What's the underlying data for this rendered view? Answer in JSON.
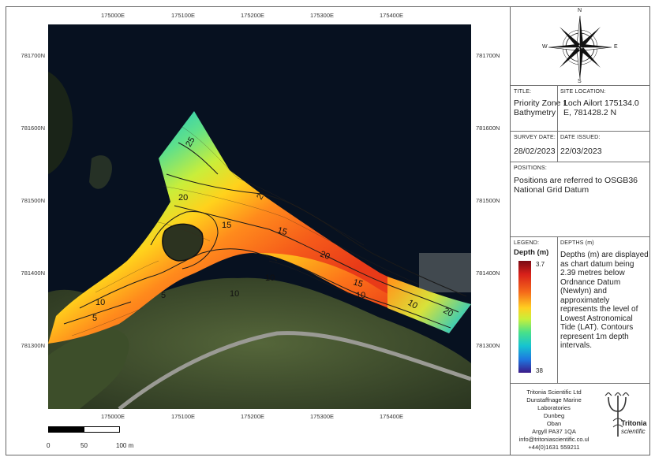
{
  "map": {
    "top_ticks": [
      "175000E",
      "175100E",
      "175200E",
      "175300E",
      "175400E"
    ],
    "bottom_ticks": [
      "175000E",
      "175100E",
      "175200E",
      "175300E",
      "175400E"
    ],
    "left_ticks": [
      "781700N",
      "781600N",
      "781500N",
      "781400N",
      "781300N"
    ],
    "right_ticks": [
      "781700N",
      "781600N",
      "781500N",
      "781400N",
      "781300N"
    ],
    "contour_labels": [
      "25",
      "20",
      "20",
      "15",
      "20",
      "15",
      "15",
      "10",
      "10",
      "10",
      "5",
      "10",
      "5",
      "20",
      "10"
    ],
    "colors": {
      "water": "#071120",
      "land": "#3a4a2a",
      "road": "#9a9a94"
    }
  },
  "compass": {
    "n": "N",
    "s": "S",
    "e": "E",
    "w": "W"
  },
  "title_block": {
    "title_label": "TITLE:",
    "title_value": "Priority Zone 1 Bathymetry",
    "site_label": "SITE LOCATION:",
    "site_value": "Loch Ailort 175134.0 E, 781428.2 N",
    "survey_label": "SURVEY DATE:",
    "survey_value": "28/02/2023",
    "issued_label": "DATE ISSUED:",
    "issued_value": "22/03/2023",
    "positions_label": "POSITIONS:",
    "positions_value": "Positions are referred to OSGB36 National Grid Datum"
  },
  "legend": {
    "label": "LEGEND:",
    "title": "Depth (m)",
    "max": "3.7",
    "min": "38",
    "depths_label": "DEPTHS (m)",
    "depths_text": "Depths (m) are displayed as chart datum being 2.39 metres below Ordnance Datum (Newlyn) and approximately represents the level of Lowest Astronomical Tide (LAT). Contours represent 1m depth intervals."
  },
  "company": {
    "lines": [
      "Tritonia Scientific Ltd",
      "Dunstaffnage Marine",
      "Laboratories",
      "Dunbeg",
      "Oban",
      "Argyll PA37 1QA",
      "info@tritoniascientific.co.ul",
      "+44(0)1631 559211"
    ],
    "logo_name": "Tritonia",
    "logo_sub": "scientific"
  },
  "scale": {
    "labels": [
      "0",
      "50",
      "100 m"
    ]
  }
}
